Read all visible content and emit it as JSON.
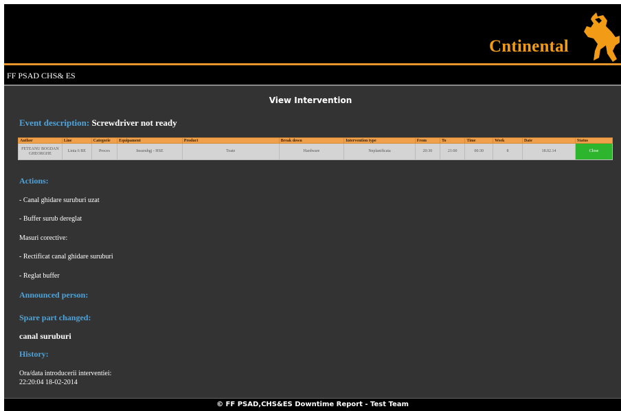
{
  "header": {
    "brand_name": "ntinental",
    "brand_logo_text": "Continental"
  },
  "nav": {
    "title": "FF PSAD CHS& ES"
  },
  "page": {
    "title": "View Intervention",
    "event_label": "Event description:",
    "event_value": "Screwdriver not ready"
  },
  "table": {
    "headers": [
      "Author",
      "Line",
      "Categorie",
      "Equipament",
      "Product",
      "Break down",
      "Intervention type",
      "From",
      "To",
      "Time",
      "Week",
      "Date",
      "Status"
    ],
    "row": [
      "FETEANU BOGDAN GHEORGHE",
      "Linia 6 BE",
      "Proces",
      "Insurubgj - HSE",
      "Toate",
      "Hardware",
      "Neplanificata",
      "20:30",
      "21:00",
      "00:30",
      "8",
      "18.02.14",
      "Close"
    ]
  },
  "actions": {
    "heading": "Actions:",
    "lines": [
      "- Canal ghidare suruburi uzat",
      "- Buffer surub dereglat",
      "Masuri corective:",
      "- Rectificat canal ghidare suruburi",
      "- Reglat buffer"
    ]
  },
  "announced": {
    "heading": "Announced person:"
  },
  "spare": {
    "heading": "Spare part changed:",
    "value": "canal suruburi"
  },
  "history": {
    "heading": "History:",
    "line1": "Ora/data introducerii interventiei:",
    "line2": "22:20:04 18-02-2014"
  },
  "footer": {
    "text": "© FF PSAD,CHS&ES Downtime Report - Test Team"
  },
  "colors": {
    "accent_orange": "#f29b17",
    "heading_blue": "#4ea3d9",
    "status_green": "#2db52d",
    "content_bg": "#333333"
  },
  "icons": {
    "logo": "continental-horse-icon"
  }
}
